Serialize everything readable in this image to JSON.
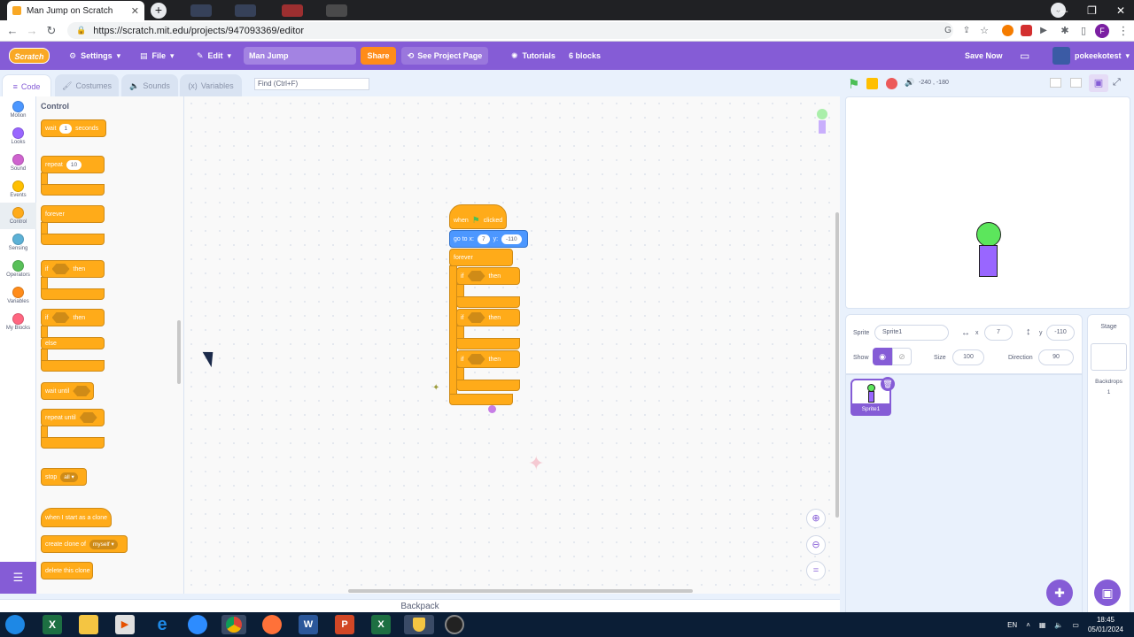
{
  "browser": {
    "tab_title": "Man Jump on Scratch",
    "url": "https://scratch.mit.edu/projects/947093369/editor",
    "profile_initial": "F"
  },
  "menubar": {
    "logo": "Scratch",
    "settings": "Settings",
    "file": "File",
    "edit": "Edit",
    "project_title": "Man Jump",
    "share": "Share",
    "see_project_page": "See Project Page",
    "tutorials": "Tutorials",
    "block_count": "6 blocks",
    "save_now": "Save Now",
    "username": "pokeekotest"
  },
  "editor_tabs": {
    "code": "Code",
    "costumes": "Costumes",
    "sounds": "Sounds",
    "variables": "Variables",
    "find_placeholder": "Find (Ctrl+F)"
  },
  "categories": [
    {
      "label": "Motion",
      "color": "#4c97ff"
    },
    {
      "label": "Looks",
      "color": "#9966ff"
    },
    {
      "label": "Sound",
      "color": "#cf63cf"
    },
    {
      "label": "Events",
      "color": "#ffbf00"
    },
    {
      "label": "Control",
      "color": "#ffab19"
    },
    {
      "label": "Sensing",
      "color": "#5cb1d6"
    },
    {
      "label": "Operators",
      "color": "#59c059"
    },
    {
      "label": "Variables",
      "color": "#ff8c1a"
    },
    {
      "label": "My Blocks",
      "color": "#ff6680"
    }
  ],
  "palette": {
    "heading": "Control",
    "wait": "wait",
    "wait_value": "1",
    "seconds": "seconds",
    "repeat": "repeat",
    "repeat_value": "10",
    "forever": "forever",
    "if1": "if",
    "then1": "then",
    "if2": "if",
    "then2": "then",
    "else": "else",
    "wait_until": "wait until",
    "repeat_until": "repeat until",
    "stop": "stop",
    "stop_option": "all",
    "when_clone": "when I start as a clone",
    "create_clone": "create clone of",
    "create_clone_option": "myself",
    "delete_clone": "delete this clone"
  },
  "script": {
    "when": "when",
    "clicked": "clicked",
    "goto_x": "go to x:",
    "x_value": "7",
    "y_label": "y:",
    "y_value": "-110",
    "forever": "forever",
    "if_a": "if",
    "then_a": "then",
    "if_b": "if",
    "then_b": "then",
    "if_c": "if",
    "then_c": "then"
  },
  "backpack": "Backpack",
  "stage_header": {
    "mouse_coords": "-240 , -180"
  },
  "sprite_info": {
    "sprite_label": "Sprite",
    "sprite_name": "Sprite1",
    "x_label": "x",
    "x_value": "7",
    "y_label": "y",
    "y_value": "-110",
    "show_label": "Show",
    "size_label": "Size",
    "size_value": "100",
    "direction_label": "Direction",
    "direction_value": "90",
    "thumb_name": "Sprite1"
  },
  "stage_pane": {
    "title": "Stage",
    "backdrops_label": "Backdrops",
    "backdrops_count": "1"
  },
  "taskbar": {
    "language": "EN",
    "time": "18:45",
    "date": "05/01/2024"
  },
  "colors": {
    "scratch_purple": "#855cd6",
    "control": "#ffab19",
    "motion": "#4c97ff",
    "head_green": "#5ce65c",
    "body_purple": "#9966ff"
  }
}
